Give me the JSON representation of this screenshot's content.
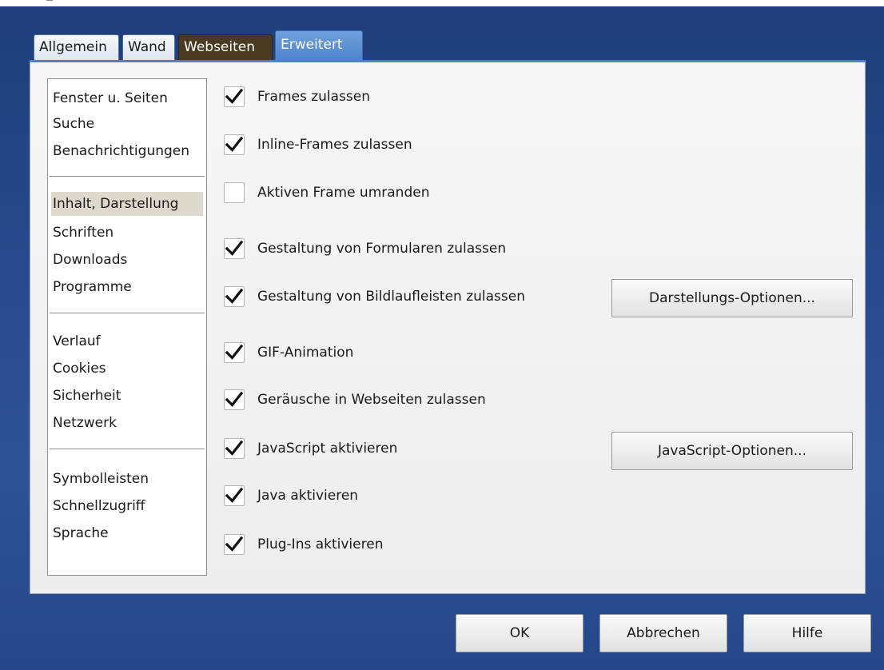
{
  "tabs": [
    {
      "label": "Allgemein"
    },
    {
      "label": "Wand"
    },
    {
      "label": "Webseiten"
    },
    {
      "label": "Erweitert"
    }
  ],
  "nav": {
    "selected": "Inhalt, Darstellung",
    "groups": [
      [
        "Fenster u. Seiten",
        "Suche",
        "Benachrichtigungen"
      ],
      [
        "Inhalt, Darstellung",
        "Schriften",
        "Downloads",
        "Programme"
      ],
      [
        "Verlauf",
        "Cookies",
        "Sicherheit",
        "Netzwerk"
      ],
      [
        "Symbolleisten",
        "Schnellzugriff",
        "Sprache"
      ]
    ]
  },
  "options": [
    {
      "label": "Frames zulassen",
      "checked": true
    },
    {
      "label": "Inline-Frames zulassen",
      "checked": true
    },
    {
      "label": "Aktiven Frame umranden",
      "checked": false
    },
    {
      "label": "Gestaltung von Formularen zulassen",
      "checked": true
    },
    {
      "label": "Gestaltung von Bildlaufleisten zulassen",
      "checked": true
    },
    {
      "label": "GIF-Animation",
      "checked": true
    },
    {
      "label": "Geräusche in Webseiten zulassen",
      "checked": true
    },
    {
      "label": "JavaScript aktivieren",
      "checked": true
    },
    {
      "label": "Java aktivieren",
      "checked": true
    },
    {
      "label": "Plug-Ins aktivieren",
      "checked": true
    }
  ],
  "buttons": {
    "display_options": "Darstellungs-Optionen...",
    "javascript_options": "JavaScript-Optionen...",
    "ok": "OK",
    "cancel": "Abbrechen",
    "help": "Hilfe"
  },
  "colors": {
    "background": "#284a8c",
    "active_tab": "#4d82c8",
    "webseiten_tab": "#4b3a22",
    "selected_nav": "#ded9cd"
  }
}
